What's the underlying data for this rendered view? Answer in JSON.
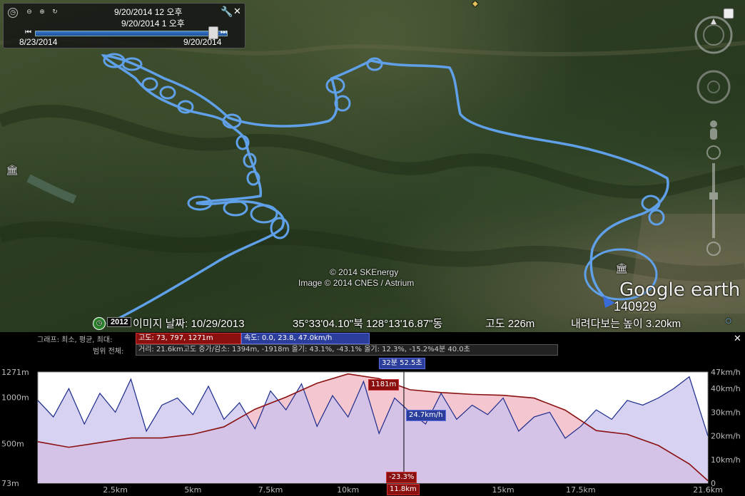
{
  "timeslider": {
    "current_start": "9/20/2014  12 오후",
    "current_end": "9/20/2014   1 오후",
    "range_start": "8/23/2014",
    "range_end": "9/20/2014"
  },
  "map": {
    "copyright_1": "© 2014 SKEnergy",
    "copyright_2": "Image © 2014 CNES / Astrium",
    "logo": "Google earth",
    "point_label": "140929",
    "status": {
      "year_badge": "2012",
      "imagery_date": "이미지 날짜: 10/29/2013",
      "coordinates": "35°33'04.10\"북 128°13'16.87\"동",
      "elevation": "고도   226m",
      "eye_alt": "내려다보는 높이   3.20km"
    },
    "icons": [
      "clock-icon",
      "zoom-out-icon",
      "zoom-in-icon",
      "refresh-icon",
      "wrench-icon",
      "close-icon",
      "compass-icon",
      "look-joystick-icon",
      "move-joystick-icon",
      "street-view-icon",
      "zoom-slider-icon",
      "museum-icon"
    ]
  },
  "profile": {
    "graph_label": "그래프: 최소, 평균, 최대:",
    "altitude_stats": "고도: 73, 797, 1271m",
    "speed_stats": "속도: 0.0, 23.8, 47.0km/h",
    "range_label": "범위 전체:",
    "range_stats": "거리: 21.6km고도 증가/감소: 1394m, -1918m 올기: 43.1%, -43.1% 올기: 12.3%, -15.2%4분 40.0초",
    "duration": "32분 52.5초",
    "cursor_altitude": "1181m",
    "cursor_speed": "24.7km/h",
    "cursor_slope": "-23.3%",
    "cursor_distance": "11.8km"
  },
  "chart_data": {
    "type": "line",
    "x_axis": {
      "label": "",
      "unit": "km",
      "range": [
        0,
        21.6
      ],
      "ticks": [
        "2.5km",
        "5km",
        "7.5km",
        "10km",
        "15km",
        "17.5km",
        "21.6km"
      ]
    },
    "y_left": {
      "label": "",
      "ticks": [
        "1271m",
        "1000m",
        "500m",
        "73m"
      ],
      "range": [
        73,
        1271
      ]
    },
    "y_right": {
      "label": "",
      "ticks": [
        "47km/h",
        "40km/h",
        "30km/h",
        "20km/h",
        "10km/h",
        "0"
      ],
      "range": [
        0,
        47
      ]
    },
    "series": [
      {
        "name": "고도",
        "unit": "m",
        "color": "#8a1010",
        "x": [
          0,
          1,
          2,
          3,
          4,
          5,
          6,
          7,
          8,
          9,
          10,
          11,
          12,
          13,
          14,
          15,
          16,
          17,
          18,
          19,
          20,
          21,
          21.6
        ],
        "y": [
          520,
          460,
          510,
          560,
          560,
          600,
          680,
          870,
          1000,
          1150,
          1250,
          1200,
          1080,
          1050,
          1030,
          1020,
          990,
          860,
          640,
          600,
          480,
          280,
          100
        ]
      },
      {
        "name": "속도",
        "unit": "km/h",
        "color": "#1a2a8a",
        "x": [
          0,
          0.5,
          1,
          1.5,
          2,
          2.5,
          3,
          3.5,
          4,
          4.5,
          5,
          5.5,
          6,
          6.5,
          7,
          7.5,
          8,
          8.5,
          9,
          9.5,
          10,
          10.5,
          11,
          11.5,
          12,
          12.5,
          13,
          13.5,
          14,
          14.5,
          15,
          15.5,
          16,
          16.5,
          17,
          17.5,
          18,
          18.5,
          19,
          19.5,
          20,
          20.5,
          21,
          21.6
        ],
        "y": [
          35,
          28,
          40,
          25,
          38,
          30,
          44,
          22,
          33,
          36,
          29,
          41,
          27,
          34,
          23,
          39,
          31,
          42,
          24,
          37,
          28,
          43,
          21,
          36,
          30,
          25,
          38,
          27,
          33,
          29,
          36,
          22,
          28,
          30,
          19,
          24,
          31,
          27,
          35,
          33,
          36,
          40,
          45,
          20
        ]
      }
    ]
  },
  "colors": {
    "altitude_fill": "#f1bcc8",
    "speed_fill": "#c9c2ee",
    "track": "#5fa0e8",
    "accent_red": "#8a1010",
    "accent_blue": "#2c3e9c"
  }
}
